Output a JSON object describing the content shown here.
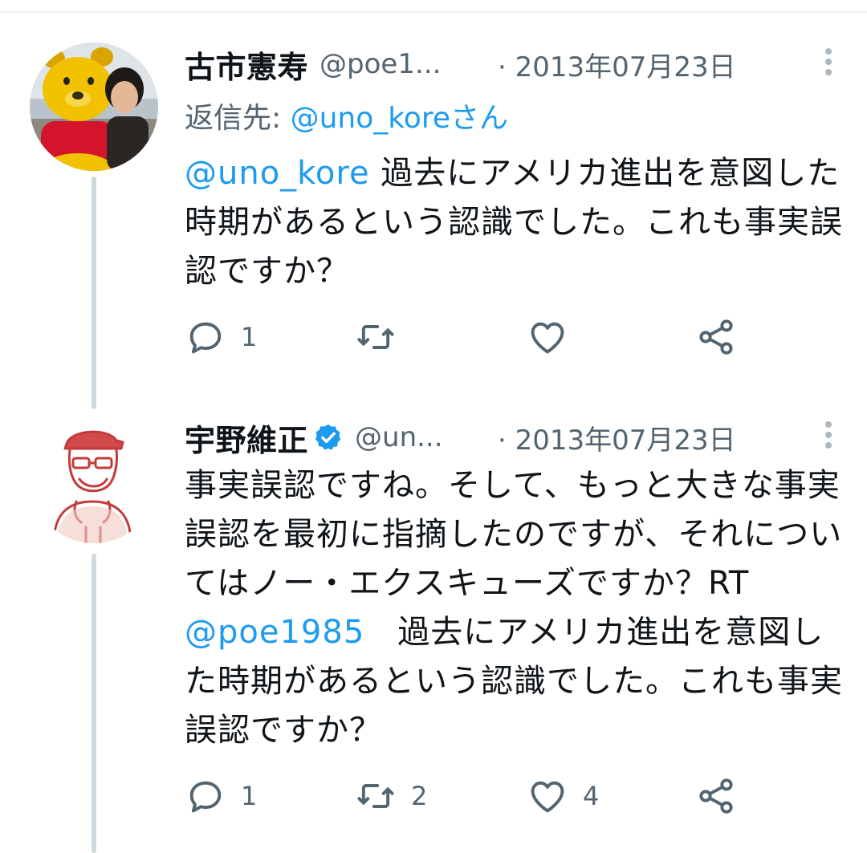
{
  "tweets": [
    {
      "name": "古市憲寿",
      "handle": "@poe1...",
      "date": "· 2013年07月23日",
      "reply_prefix": "返信先: ",
      "reply_mention": "@uno_koreさん",
      "text_mention": "@uno_kore",
      "text": " 過去にアメリカ進出を意図した時期があるという認識でした。これも事実誤認ですか？",
      "counts": {
        "replies": "1",
        "retweets": "",
        "likes": ""
      },
      "avatar_icon": "winnie-the-pooh-photo-avatar"
    },
    {
      "name": "宇野維正",
      "verified_icon": "verified-badge-icon",
      "handle": "@un...",
      "date": "· 2013年07月23日",
      "text_before": "事実誤認ですね。そして、もっと大きな事実誤認を最初に指摘したのですが、それについてはノー・エクスキューズですか？RT ",
      "text_mention": "@poe1985",
      "text_after": "　過去にアメリカ進出を意図した時期があるという認識でした。これも事実誤認ですか？",
      "counts": {
        "replies": "1",
        "retweets": "2",
        "likes": "4"
      },
      "avatar_icon": "illustrated-man-with-cap-avatar"
    }
  ],
  "colors": {
    "accent": "#1d9bf0",
    "muted": "#536471",
    "thread_line": "#cfd9de"
  }
}
